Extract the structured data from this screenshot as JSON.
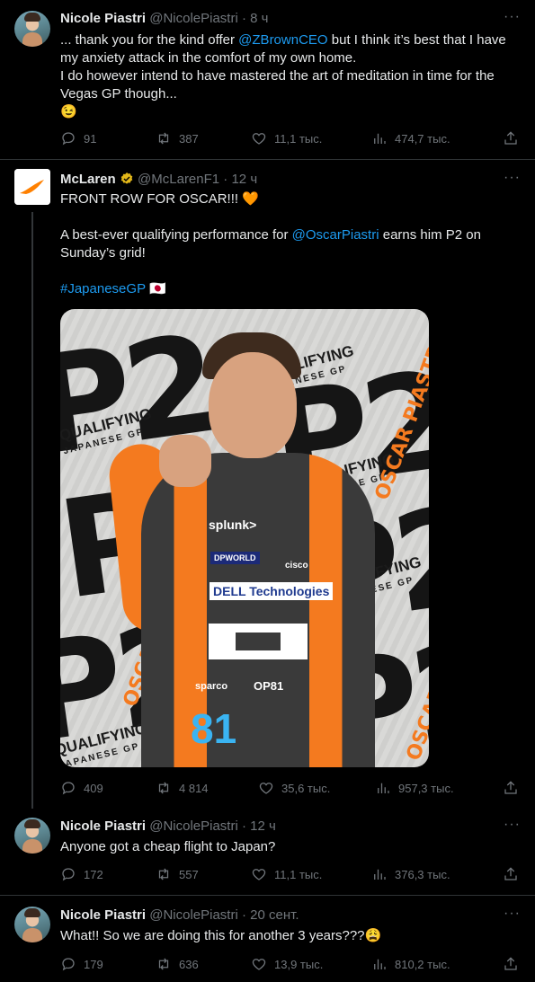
{
  "tweets": [
    {
      "name": "Nicole Piastri",
      "handle": "@NicolePiastri",
      "dot": "·",
      "time": "8 ч",
      "text": {
        "l1_a": "... thank you for the kind offer ",
        "l1_link": "@ZBrownCEO",
        "l1_b": " but I think it’s best that I have",
        "l2": "my anxiety attack in the comfort of my own home.",
        "l3": "I do however intend to have mastered the art of meditation in time for the",
        "l4": "Vegas GP though...",
        "l5": "😉"
      },
      "stats": {
        "replies": "91",
        "retweets": "387",
        "likes": "11,1 тыс.",
        "views": "474,7 тыс."
      }
    },
    {
      "name": "McLaren",
      "verified_icon": "verified-badge-gold",
      "handle": "@McLarenF1",
      "dot": "·",
      "time": "12 ч",
      "text": {
        "l1": "FRONT ROW FOR OSCAR!!! 🧡",
        "l2_a": "A best-ever qualifying performance for ",
        "l2_link": "@OscarPiastri",
        "l2_b": " earns him P2 on",
        "l3": "Sunday’s grid!",
        "hashtag": "#JapaneseGP",
        "flag": "🇯🇵"
      },
      "media": {
        "p2": "P2",
        "oscar": "OSCAR PIASTRI",
        "qualifying": "QUALIFYING",
        "gp": "JAPANESE GP",
        "sponsors": [
          "splunk>",
          "DPWORLD",
          "cisco",
          "DELL Technologies",
          "sparco",
          "OP81",
          "81"
        ]
      },
      "stats": {
        "replies": "409",
        "retweets": "4 814",
        "likes": "35,6 тыс.",
        "views": "957,3 тыс."
      }
    },
    {
      "name": "Nicole Piastri",
      "handle": "@NicolePiastri",
      "dot": "·",
      "time": "12 ч",
      "text": {
        "l1": "Anyone got a cheap flight to Japan?"
      },
      "stats": {
        "replies": "172",
        "retweets": "557",
        "likes": "11,1 тыс.",
        "views": "376,3 тыс."
      }
    },
    {
      "name": "Nicole Piastri",
      "handle": "@NicolePiastri",
      "dot": "·",
      "time": "20 сент.",
      "text": {
        "l1": "What!! So we are doing this for another 3 years???😩"
      },
      "stats": {
        "replies": "179",
        "retweets": "636",
        "likes": "13,9 тыс.",
        "views": "810,2 тыс."
      }
    }
  ],
  "more_label": "···",
  "colors": {
    "background": "#000000",
    "text": "#e7e9ea",
    "muted": "#71767b",
    "link": "#1d9bf0",
    "divider": "#2f3336",
    "mclaren_orange": "#f47a1f"
  }
}
